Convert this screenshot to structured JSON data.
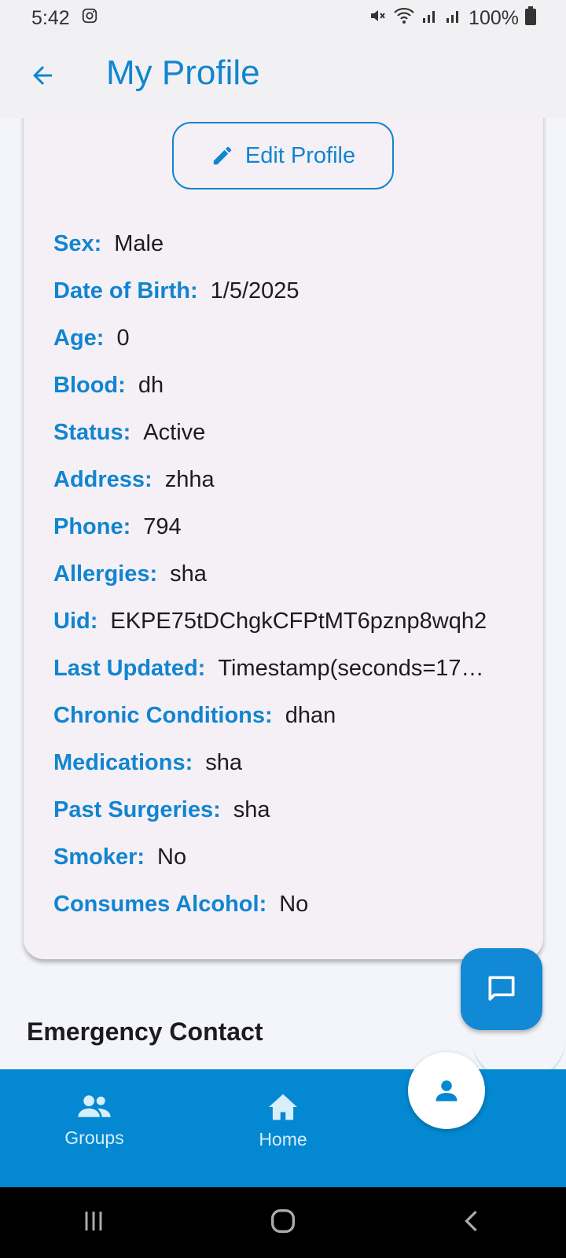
{
  "status_bar": {
    "time": "5:42",
    "battery": "100%"
  },
  "app_bar": {
    "title": "My Profile"
  },
  "profile": {
    "edit_label": "Edit Profile",
    "fields": [
      {
        "label": "Sex:",
        "value": "Male"
      },
      {
        "label": "Date of Birth:",
        "value": "1/5/2025"
      },
      {
        "label": "Age:",
        "value": "0"
      },
      {
        "label": "Blood:",
        "value": "dh"
      },
      {
        "label": "Status:",
        "value": "Active"
      },
      {
        "label": "Address:",
        "value": "zhha"
      },
      {
        "label": "Phone:",
        "value": "794"
      },
      {
        "label": "Allergies:",
        "value": "sha"
      },
      {
        "label": "Uid:",
        "value": "EKPE75tDChgkCFPtMT6pznp8wqh2"
      },
      {
        "label": "Last Updated:",
        "value": "Timestamp(seconds=17…"
      },
      {
        "label": "Chronic Conditions:",
        "value": "dhan"
      },
      {
        "label": "Medications:",
        "value": "sha"
      },
      {
        "label": "Past Surgeries:",
        "value": "sha"
      },
      {
        "label": "Smoker:",
        "value": "No"
      },
      {
        "label": "Consumes Alcohol:",
        "value": "No"
      }
    ]
  },
  "emergency": {
    "title": "Emergency Contact"
  },
  "bottom_nav": {
    "items": [
      {
        "label": "Groups",
        "icon": "groups-icon"
      },
      {
        "label": "Home",
        "icon": "home-icon"
      }
    ],
    "profile_icon": "person-icon"
  },
  "colors": {
    "accent": "#1185cf",
    "nav_bg": "#0388d1",
    "card_bg": "#f5f0f6"
  }
}
